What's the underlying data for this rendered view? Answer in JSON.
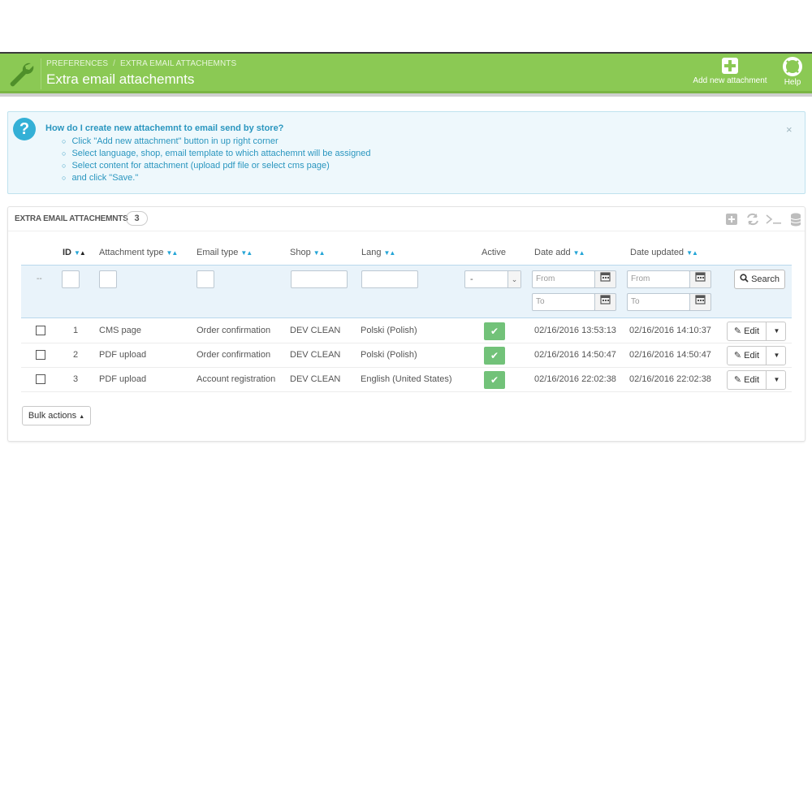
{
  "header": {
    "breadcrumb": [
      "PREFERENCES",
      "EXTRA EMAIL ATTACHEMNTS"
    ],
    "breadcrumb_sep": "/",
    "title": "Extra email attachemnts",
    "add_label": "Add new attachment",
    "help_label": "Help",
    "color": "#8bc954"
  },
  "alert": {
    "title": "How do I create new attachemnt to email send by store?",
    "items": [
      "Click \"Add new attachment\" button in up right corner",
      "Select language, shop, email template to which attachemnt will be assigned",
      "Select content for attachment (upload pdf file or select cms page)",
      "and click \"Save.\""
    ],
    "close": "×"
  },
  "panel": {
    "title": "EXTRA EMAIL ATTACHEMNTS",
    "count": "3"
  },
  "table": {
    "columns": {
      "id": "ID",
      "attachment_type": "Attachment type",
      "email_type": "Email type",
      "shop": "Shop",
      "lang": "Lang",
      "active": "Active",
      "date_add": "Date add",
      "date_updated": "Date updated"
    },
    "filters": {
      "dashes": "--",
      "active_value": "-",
      "from_placeholder": "From",
      "to_placeholder": "To",
      "search_label": "Search"
    },
    "rows": [
      {
        "id": "1",
        "attachment_type": "CMS page",
        "email_type": "Order confirmation",
        "shop": "DEV CLEAN",
        "lang": "Polski (Polish)",
        "active": true,
        "date_add": "02/16/2016 13:53:13",
        "date_updated": "02/16/2016 14:10:37",
        "edit": "Edit"
      },
      {
        "id": "2",
        "attachment_type": "PDF upload",
        "email_type": "Order confirmation",
        "shop": "DEV CLEAN",
        "lang": "Polski (Polish)",
        "active": true,
        "date_add": "02/16/2016 14:50:47",
        "date_updated": "02/16/2016 14:50:47",
        "edit": "Edit"
      },
      {
        "id": "3",
        "attachment_type": "PDF upload",
        "email_type": "Account registration",
        "shop": "DEV CLEAN",
        "lang": "English (United States)",
        "active": true,
        "date_add": "02/16/2016 22:02:38",
        "date_updated": "02/16/2016 22:02:38",
        "edit": "Edit"
      }
    ],
    "bulk_actions": "Bulk actions"
  },
  "icons": {
    "header": [
      "wrench-icon",
      "plus-square-icon",
      "lifebuoy-icon"
    ],
    "alert": "question-circle-icon",
    "toolbar": [
      "add-icon",
      "refresh-icon",
      "sql-terminal-icon",
      "database-icon"
    ],
    "active": "check-icon",
    "calendar": "calendar-icon",
    "search": "search-icon",
    "edit": "pencil-icon"
  }
}
